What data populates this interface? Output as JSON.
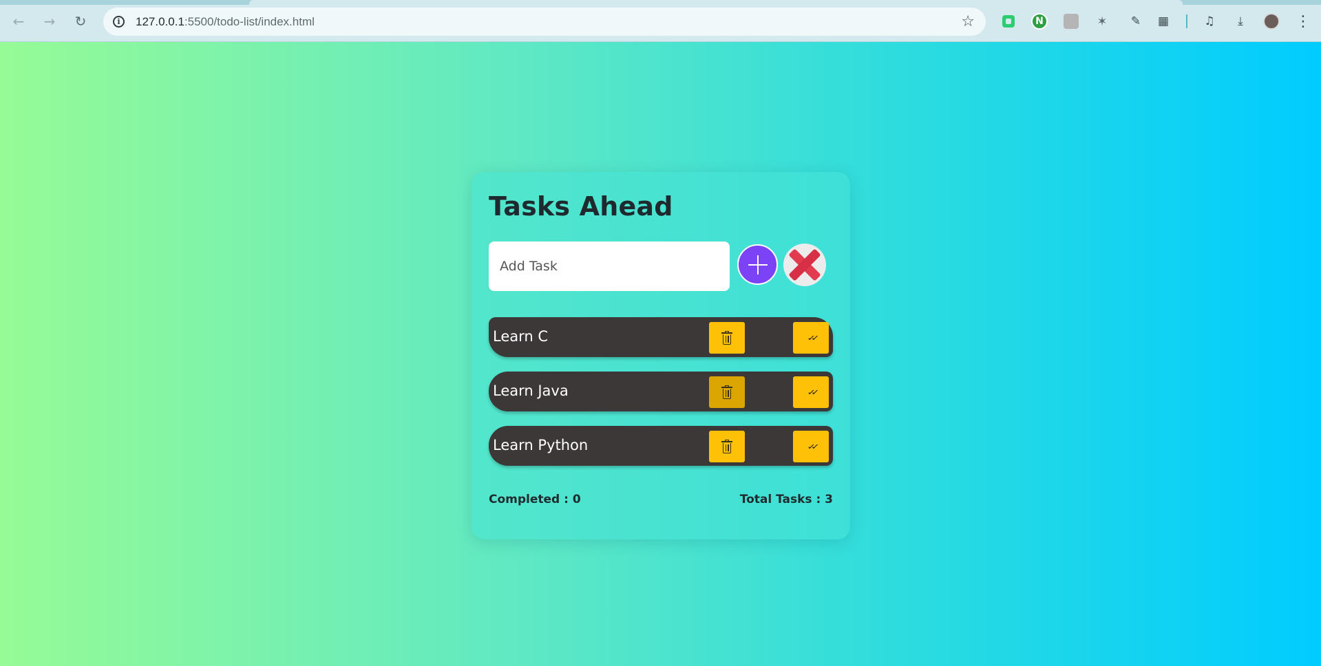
{
  "browser": {
    "url_host": "127.0.0.1",
    "url_path": ":5500/todo-list/index.html",
    "back_icon": "arrow-left-icon",
    "forward_icon": "arrow-right-icon",
    "reload_icon": "reload-icon",
    "bookmark_icon": "star-icon",
    "n_extension_label": "N",
    "colors": {
      "chrome_bg": "#d3e9ee",
      "omnibox_bg": "#f1f8fa"
    }
  },
  "app": {
    "title": "Tasks Ahead",
    "input": {
      "placeholder": "Add Task",
      "value": ""
    },
    "add_button_icon": "plus-icon",
    "clear_button_icon": "cross-icon",
    "tasks": [
      {
        "name": "Learn C",
        "delete_icon": "trash-icon",
        "complete_icon": "double-check-icon"
      },
      {
        "name": "Learn Java",
        "delete_icon": "trash-icon",
        "complete_icon": "double-check-icon"
      },
      {
        "name": "Learn Python",
        "delete_icon": "trash-icon",
        "complete_icon": "double-check-icon"
      }
    ],
    "completed_text": "Completed : 0",
    "total_text": "Total Tasks : 3",
    "colors": {
      "gradient_start": "#96fb96",
      "gradient_end": "#00ccff",
      "task_bg": "#3d3838",
      "action_button": "#ffc107",
      "add_button": "#7b42f6",
      "clear_cross": "#e23a4f"
    }
  }
}
